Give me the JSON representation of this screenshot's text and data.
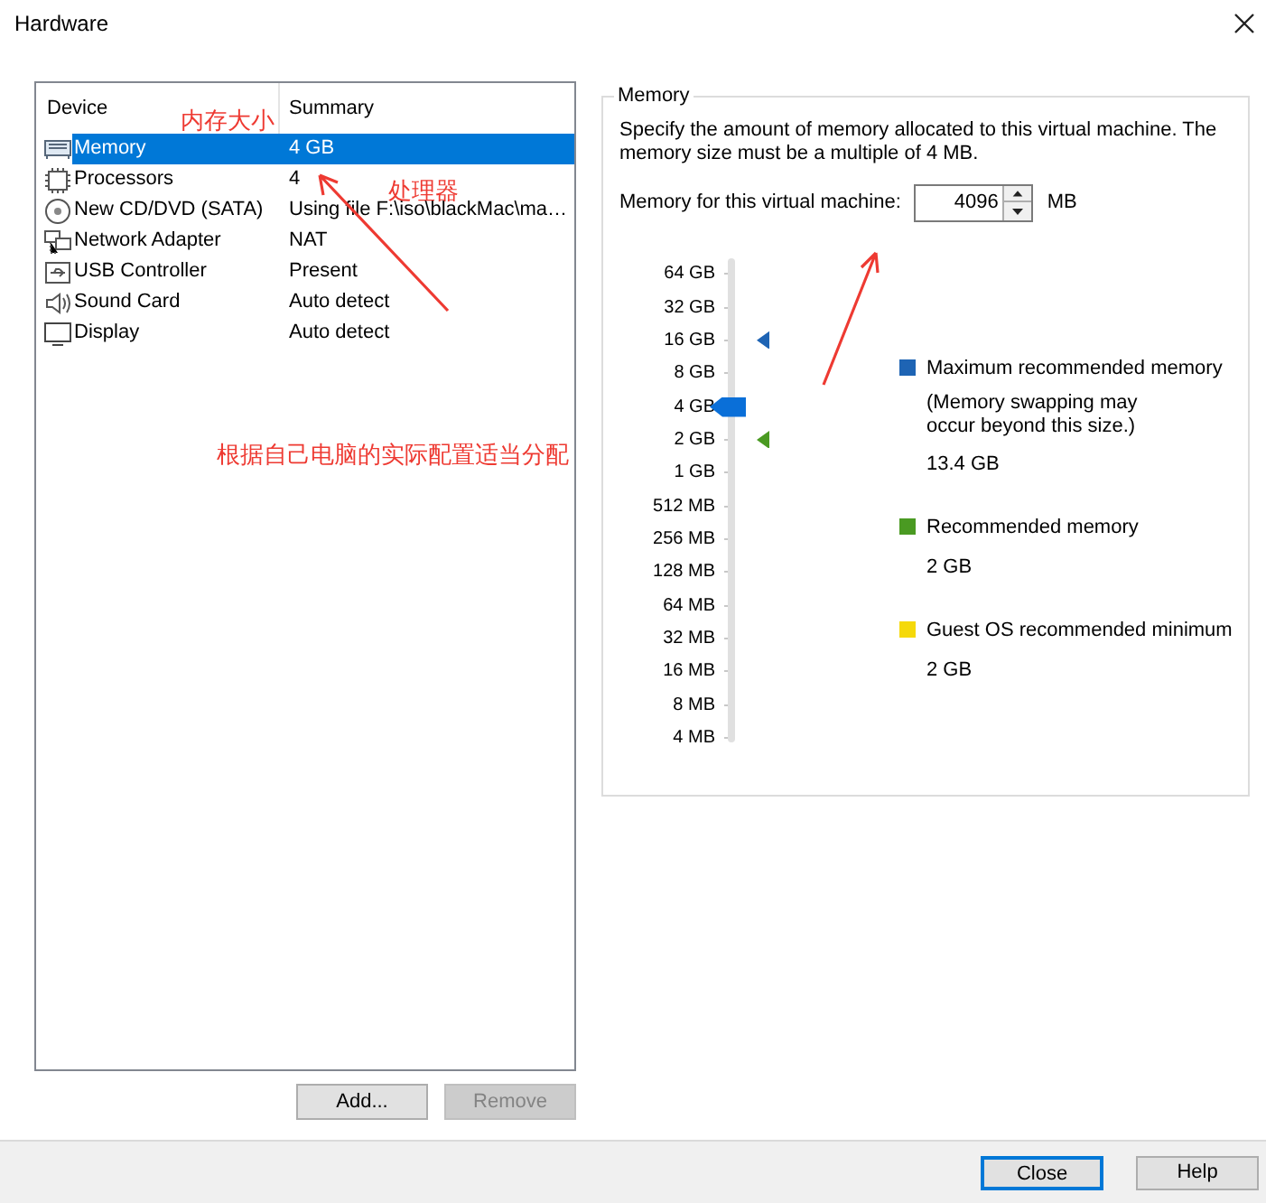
{
  "window": {
    "title": "Hardware"
  },
  "device_table": {
    "columns": [
      "Device",
      "Summary"
    ],
    "rows": [
      {
        "kind": "memory",
        "device": "Memory",
        "summary": "4 GB",
        "selected": true
      },
      {
        "kind": "processor",
        "device": "Processors",
        "summary": "4",
        "selected": false
      },
      {
        "kind": "cd",
        "device": "New CD/DVD (SATA)",
        "summary": "Using file F:\\iso\\blackMac\\ma…",
        "selected": false
      },
      {
        "kind": "network",
        "device": "Network Adapter",
        "summary": "NAT",
        "selected": false
      },
      {
        "kind": "usb",
        "device": "USB Controller",
        "summary": "Present",
        "selected": false
      },
      {
        "kind": "sound",
        "device": "Sound Card",
        "summary": "Auto detect",
        "selected": false
      },
      {
        "kind": "display",
        "device": "Display",
        "summary": "Auto detect",
        "selected": false
      }
    ]
  },
  "device_buttons": [
    {
      "label": "Add...",
      "disabled": false
    },
    {
      "label": "Remove",
      "disabled": true
    }
  ],
  "memory_group": {
    "title": "Memory",
    "description": "Specify the amount of memory allocated to this virtual machine. The memory size must be a multiple of 4 MB.",
    "field_label": "Memory for this virtual machine:",
    "value": "4096",
    "unit": "MB",
    "slider": {
      "ticks": [
        "64 GB",
        "32 GB",
        "16 GB",
        "8 GB",
        "4 GB",
        "2 GB",
        "1 GB",
        "512 MB",
        "256 MB",
        "128 MB",
        "64 MB",
        "32 MB",
        "16 MB",
        "8 MB",
        "4 MB"
      ],
      "level": 0.714,
      "markers": [
        {
          "level": 0.857,
          "color": "#1e64b4"
        },
        {
          "level": 0.643,
          "color": "#4a9a22"
        }
      ]
    },
    "legend": [
      {
        "label": "Maximum recommended memory",
        "note": "(Memory swapping may occur beyond this size.)",
        "value": "13.4 GB",
        "color": "#1e64b4"
      },
      {
        "label": "Recommended memory",
        "value": "2 GB",
        "color": "#4a9a22"
      },
      {
        "label": "Guest OS recommended minimum",
        "value": "2 GB",
        "color": "#f5d90a"
      }
    ]
  },
  "annotations": [
    "内存大小",
    "处理器",
    "根据自己电脑的实际配置适当分配"
  ],
  "footer_buttons": [
    {
      "label": "Close",
      "default": true
    },
    {
      "label": "Help",
      "default": false
    }
  ]
}
